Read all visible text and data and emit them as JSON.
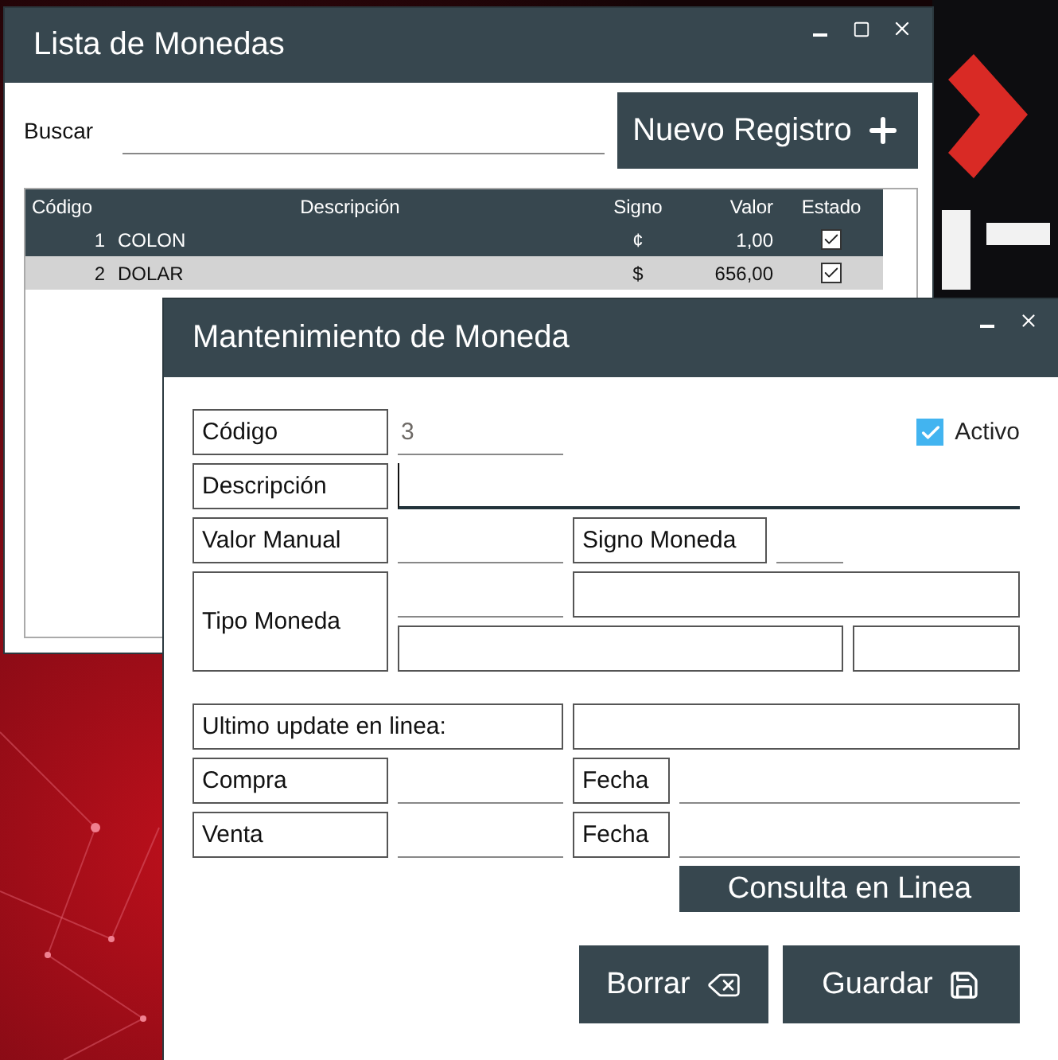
{
  "list_window": {
    "title": "Lista de Monedas",
    "search": {
      "label": "Buscar"
    },
    "new_button": "Nuevo Registro",
    "table": {
      "columns": [
        "Código",
        "Descripción",
        "Signo",
        "Valor",
        "Estado"
      ],
      "rows": [
        {
          "code": "1",
          "description": "COLON",
          "sign": "¢",
          "value": "1,00",
          "active": true,
          "selected": true
        },
        {
          "code": "2",
          "description": "DOLAR",
          "sign": "$",
          "value": "656,00",
          "active": true,
          "selected": false
        }
      ]
    }
  },
  "form_window": {
    "title": "Mantenimiento de Moneda",
    "code": {
      "label": "Código",
      "value": "3"
    },
    "active": {
      "label": "Activo",
      "checked": true
    },
    "description": {
      "label": "Descripción",
      "focused": true
    },
    "manual_value": {
      "label": "Valor Manual"
    },
    "currency_sign": {
      "label": "Signo Moneda"
    },
    "currency_type": {
      "label": "Tipo Moneda"
    },
    "last_update": {
      "label": "Ultimo update en linea:"
    },
    "purchase": {
      "label": "Compra",
      "date_label": "Fecha"
    },
    "sale": {
      "label": "Venta",
      "date_label": "Fecha"
    },
    "buttons": {
      "query": "Consulta en Linea",
      "delete": "Borrar",
      "save": "Guardar"
    }
  }
}
